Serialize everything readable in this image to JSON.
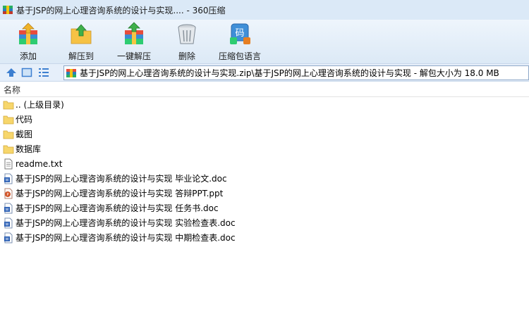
{
  "window": {
    "title": "基于JSP的网上心理咨询系统的设计与实现.... - 360压缩"
  },
  "toolbar": {
    "buttons": [
      {
        "label": "添加",
        "icon": "add-archive-icon"
      },
      {
        "label": "解压到",
        "icon": "extract-to-icon"
      },
      {
        "label": "一键解压",
        "icon": "one-click-extract-icon"
      },
      {
        "label": "删除",
        "icon": "delete-bin-icon"
      },
      {
        "label": "压缩包语言",
        "icon": "archive-language-icon"
      }
    ]
  },
  "addressbar": {
    "path": "基于JSP的网上心理咨询系统的设计与实现.zip\\基于JSP的网上心理咨询系统的设计与实现 - 解包大小为 18.0 MB"
  },
  "list": {
    "column_name": "名称",
    "items": [
      {
        "name": ".. (上级目录)",
        "type": "folder"
      },
      {
        "name": "代码",
        "type": "folder"
      },
      {
        "name": "截图",
        "type": "folder"
      },
      {
        "name": "数据库",
        "type": "folder"
      },
      {
        "name": "readme.txt",
        "type": "txt"
      },
      {
        "name": "基于JSP的网上心理咨询系统的设计与实现 毕业论文.doc",
        "type": "doc"
      },
      {
        "name": "基于JSP的网上心理咨询系统的设计与实现 答辩PPT.ppt",
        "type": "ppt"
      },
      {
        "name": "基于JSP的网上心理咨询系统的设计与实现 任务书.doc",
        "type": "doc"
      },
      {
        "name": "基于JSP的网上心理咨询系统的设计与实现 实验检查表.doc",
        "type": "doc"
      },
      {
        "name": "基于JSP的网上心理咨询系统的设计与实现 中期检查表.doc",
        "type": "doc"
      }
    ]
  },
  "colors": {
    "folder": "#f7d66b",
    "doc": "#2b5fb4",
    "ppt": "#d2562a",
    "accent": "#3d7fd0"
  }
}
